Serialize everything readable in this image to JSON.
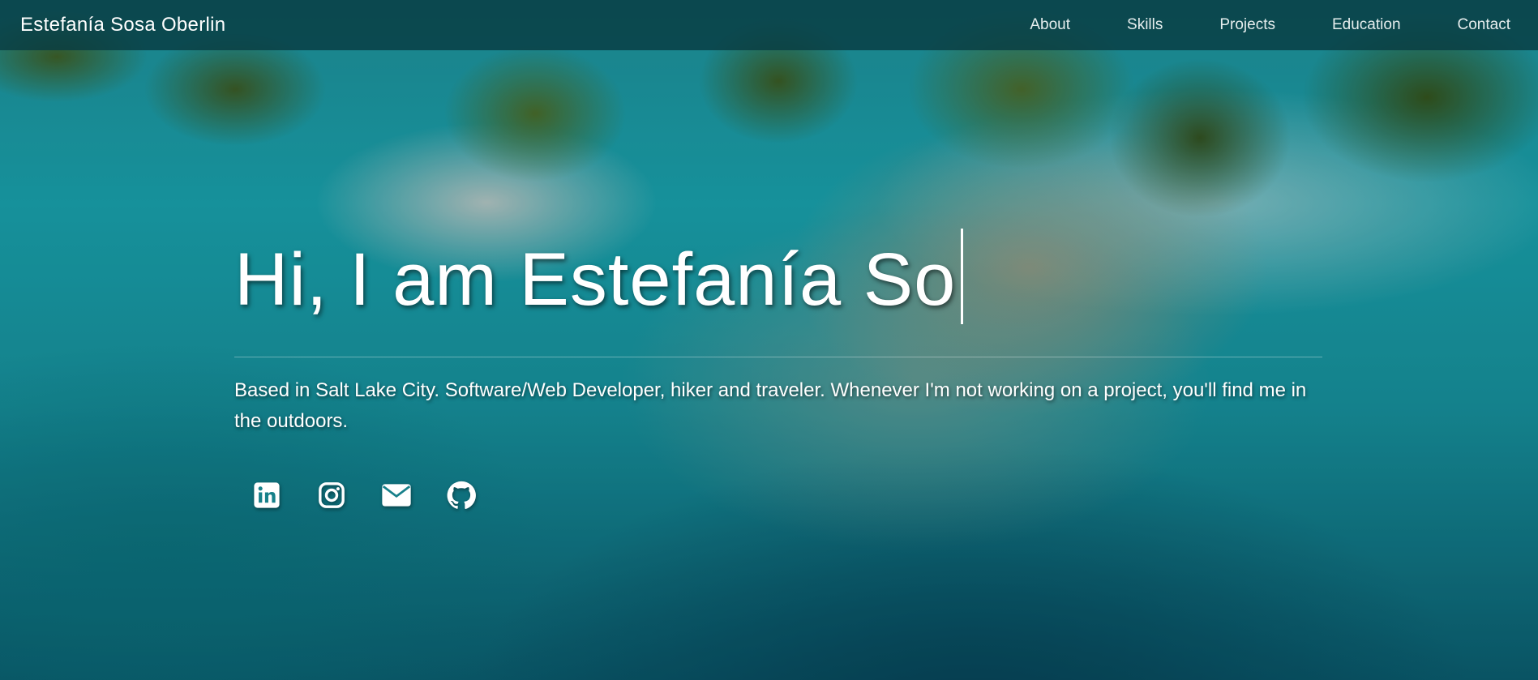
{
  "navbar": {
    "brand": "Estefanía Sosa Oberlin",
    "links": [
      {
        "label": "About"
      },
      {
        "label": "Skills"
      },
      {
        "label": "Projects"
      },
      {
        "label": "Education"
      },
      {
        "label": "Contact"
      }
    ]
  },
  "hero": {
    "title_typed": "Hi, I am Estefanía So",
    "description": "Based in Salt Lake City. Software/Web Developer, hiker and traveler. Whenever I'm not working on a project, you'll find me in the outdoors."
  },
  "socials": [
    {
      "icon": "linkedin-icon"
    },
    {
      "icon": "instagram-icon"
    },
    {
      "icon": "email-icon"
    },
    {
      "icon": "github-icon"
    }
  ],
  "colors": {
    "navbar_bg": "#083c42",
    "text": "#ffffff",
    "ocean": "#1aa1ab"
  }
}
